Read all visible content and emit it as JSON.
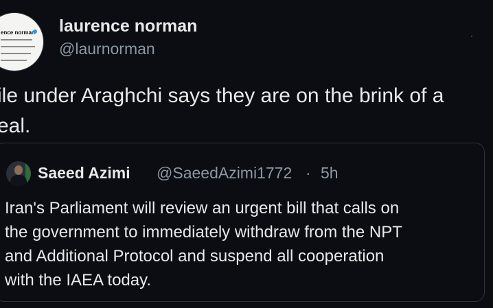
{
  "tweet": {
    "author": {
      "name": "laurence norman",
      "handle": "@laurnorman",
      "avatar_preview_name": "ence norman"
    },
    "text_lines": [
      "ile under Araghchi says they are on the brink of a",
      "eal."
    ]
  },
  "quoted_tweet": {
    "author": {
      "name": "Saeed Azimi",
      "handle": "@SaeedAzimi1772",
      "separator": "·",
      "time": "5h"
    },
    "text_lines": [
      "Iran's Parliament will review an urgent bill that calls on",
      "the government to immediately withdraw from the NPT",
      "and Additional Protocol and suspend all cooperation",
      "with the IAEA today."
    ]
  },
  "colors": {
    "background": "#0b0d12",
    "text_primary": "#e7e9ea",
    "text_secondary": "#8b98a5",
    "border": "#2f3336",
    "verified_badge": "#1d9bf0"
  },
  "icons": {
    "author_avatar": "profile-screenshot-avatar",
    "quoted_avatar": "person-in-suit-avatar"
  }
}
